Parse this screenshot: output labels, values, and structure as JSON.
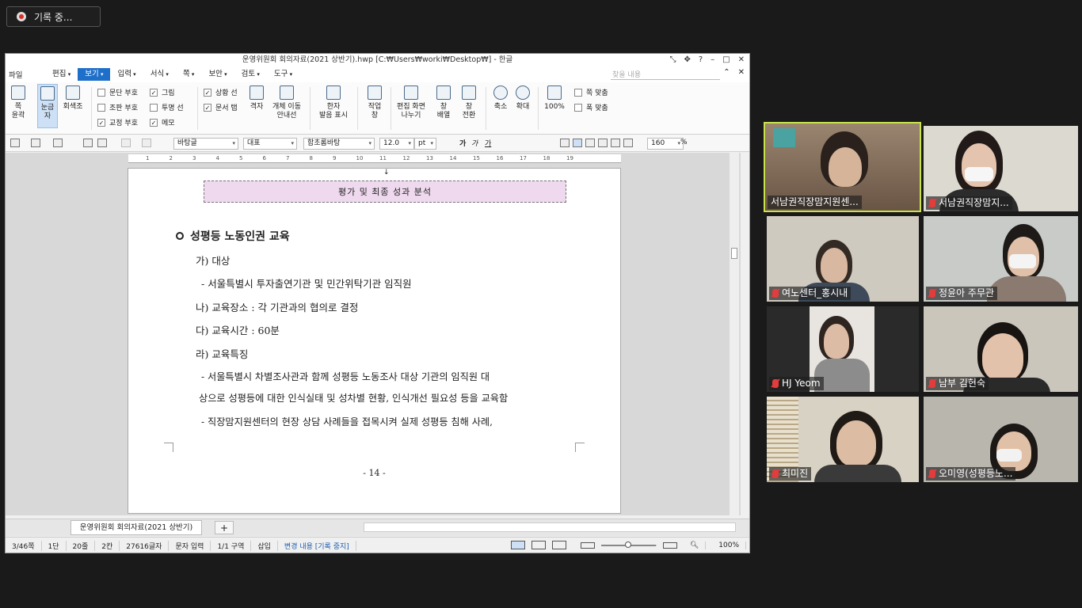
{
  "recording": {
    "label": "기록 중..."
  },
  "window": {
    "title": "운영위원회 회의자료(2021 상반기).hwp [C:₩Users₩worki₩Desktop₩] - 한글",
    "menus": [
      "편집",
      "보기",
      "입력",
      "서식",
      "쪽",
      "보안",
      "검토",
      "도구"
    ],
    "file_menu": "파일",
    "active_menu": "보기",
    "search_placeholder": "찾을 내용"
  },
  "ribbon": {
    "buttons": {
      "page_outline": "쪽\n윤곽",
      "ruler": "눈금자",
      "grayscale": "회색조",
      "grid": "격자",
      "object_move": "개체 이동\n안내선",
      "hanja": "한자\n발음 표시",
      "work_window": "작업\n창",
      "split_screen": "편집 화면\n나누기",
      "arrange": "창\n배열",
      "switch": "창\n전환",
      "zoom_out": "축소",
      "zoom_in": "확대",
      "zoom_100": "100%",
      "fit_width": "쪽 맞춤",
      "fit_page": "폭 맞춤"
    },
    "checks": [
      {
        "label": "문단 부호",
        "checked": false
      },
      {
        "label": "조판 부호",
        "checked": false
      },
      {
        "label": "교정 부호",
        "checked": true
      },
      {
        "label": "그림",
        "checked": true
      },
      {
        "label": "투명 선",
        "checked": false
      },
      {
        "label": "메모",
        "checked": true
      },
      {
        "label": "상황 선",
        "checked": true
      },
      {
        "label": "문서 탭",
        "checked": true
      }
    ]
  },
  "format": {
    "style": "바탕글",
    "lang": "대표",
    "font": "함초롬바탕",
    "size": "12.0",
    "unit": "pt",
    "bold": "가",
    "italic": "가",
    "underline": "가",
    "zoom": "160",
    "zoom_unit": "%"
  },
  "ruler_ticks": [
    "1",
    "2",
    "3",
    "4",
    "5",
    "6",
    "7",
    "8",
    "9",
    "10",
    "11",
    "12",
    "13",
    "14",
    "15",
    "16",
    "17",
    "18",
    "19"
  ],
  "document": {
    "box_text": "평가 및 최종 성과 분석",
    "heading": "성평등 노동인권 교육",
    "lines": [
      "가) 대상",
      "- 서울특별시 투자출연기관 및 민간위탁기관 임직원",
      "나) 교육장소 : 각 기관과의 협의로 결정",
      "다) 교육시간 : 60분",
      "라) 교육특징",
      "- 서울특별시 차별조사관과 함께 성평등 노동조사 대상 기관의 임직원 대",
      "상으로 성평등에 대한 인식실태 및 성차별 현황, 인식개선 필요성 등을 교육함",
      "- 직장맘지원센터의 현장 상담 사례들을 접목시켜 실제 성평등 침해 사례,"
    ],
    "page_number": "- 14 -"
  },
  "tabbar": {
    "doc_tab": "운영위원회 회의자료(2021 상반기)",
    "add": "+"
  },
  "status": {
    "page": "3/46쪽",
    "column": "1단",
    "line": "20줄",
    "col": "2칸",
    "chars": "27616글자",
    "mode": "문자 입력",
    "section": "1/1 구역",
    "insert": "삽입",
    "track": "변경 내용 [기록 중지]",
    "zoom": "100%"
  },
  "participants": [
    {
      "name": "서남권직장맘지원센...",
      "muted": false,
      "active": true
    },
    {
      "name": "서남권직장맘지...",
      "muted": true,
      "active": false
    },
    {
      "name": "여노센터_홍시내",
      "muted": true,
      "active": false
    },
    {
      "name": "정윤아 주무관",
      "muted": true,
      "active": false
    },
    {
      "name": "HJ Yeom",
      "muted": true,
      "active": false
    },
    {
      "name": "남부 김현숙",
      "muted": true,
      "active": false
    },
    {
      "name": "최미진",
      "muted": true,
      "active": false
    },
    {
      "name": "오미영(성평등노...",
      "muted": true,
      "active": false
    }
  ]
}
